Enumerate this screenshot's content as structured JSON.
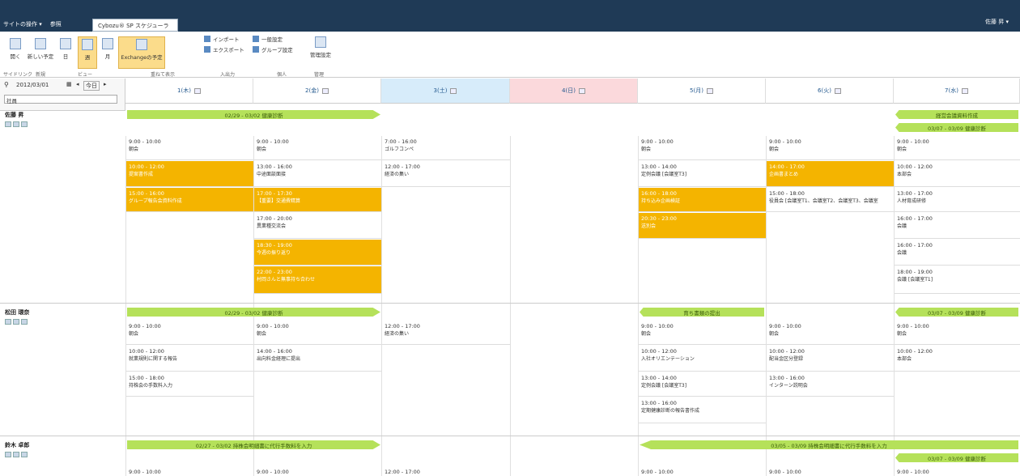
{
  "topbar": {
    "menu": [
      "サイトの操作 ▾",
      "参照"
    ],
    "tab": "Cybozu® SP スケジューラー",
    "user": "佐藤 昇 ▾"
  },
  "ribbon": {
    "open": "開く",
    "new": "新しい予定",
    "day": "日",
    "week": "週",
    "month": "月",
    "exchange": "Exchangeの予定",
    "import": "インポート",
    "export": "エクスポート",
    "general": "一般設定",
    "group": "グループ設定",
    "admin": "管理設定",
    "groups": [
      "サイドリンク",
      "新規",
      "ビュー",
      "重ねて表示",
      "入出力",
      "個人",
      "管理"
    ]
  },
  "nav": {
    "date": "2012/03/01",
    "today": "今日",
    "kind": "社員"
  },
  "days": [
    "1(木)",
    "2(金)",
    "3(土)",
    "4(日)",
    "5(月)",
    "6(火)",
    "7(水)"
  ],
  "people": [
    {
      "name": "佐藤 昇",
      "banners": [
        {
          "t": "02/29 - 03/02 健康診断"
        },
        {
          "t": "経営会議資料作成"
        },
        {
          "t": "03/07 - 03/09 健康診断"
        }
      ],
      "events": [
        {
          "t": "9:00 - 10:00",
          "s": "朝会"
        },
        {
          "t": "10:00 - 12:00",
          "s": "提案書作成"
        },
        {
          "t": "15:00 - 16:00",
          "s": "グループ報告会資料作成"
        },
        {
          "t": "9:00 - 10:00",
          "s": "朝会"
        },
        {
          "t": "13:00 - 16:00",
          "s": "中途面談面接"
        },
        {
          "t": "17:00 - 17:30",
          "s": "【重要】交通費精算"
        },
        {
          "t": "17:00 - 20:00",
          "s": "異業種交流会"
        },
        {
          "t": "18:30 - 19:00",
          "s": "今週の振り返り"
        },
        {
          "t": "22:00 - 23:00",
          "s": "村岡さんと無事持ち合わせ"
        },
        {
          "t": "7:00 - 16:00",
          "s": "ゴルフコンペ"
        },
        {
          "t": "12:00 - 17:00",
          "s": "経済の集い"
        },
        {
          "t": "9:00 - 10:00",
          "s": "朝会"
        },
        {
          "t": "13:00 - 14:00",
          "s": "定例会議 [会議室T3]"
        },
        {
          "t": "16:00 - 18:00",
          "s": "持ち込み企画検証"
        },
        {
          "t": "20:30 - 23:00",
          "s": "送別会"
        },
        {
          "t": "9:00 - 10:00",
          "s": "朝会"
        },
        {
          "t": "14:00 - 17:00",
          "s": "企画書まとめ"
        },
        {
          "t": "15:00 - 18:00",
          "s": "役員会 [会議室T1、会議室T2、会議室T3、会議室"
        },
        {
          "t": "9:00 - 10:00",
          "s": "朝会"
        },
        {
          "t": "10:00 - 12:00",
          "s": "本部会"
        },
        {
          "t": "13:00 - 17:00",
          "s": "人材育成研修"
        },
        {
          "t": "16:00 - 17:00",
          "s": "会議"
        },
        {
          "t": "16:00 - 17:00",
          "s": "会議"
        },
        {
          "t": "18:00 - 19:00",
          "s": "会議 [会議室T1]"
        }
      ]
    },
    {
      "name": "松田 環奈",
      "banners": [
        {
          "t": "02/29 - 03/02 健康診断"
        },
        {
          "t": "育ち書類の提出"
        },
        {
          "t": "03/07 - 03/09 健康診断"
        }
      ],
      "events": [
        {
          "t": "9:00 - 10:00",
          "s": "朝会"
        },
        {
          "t": "10:00 - 12:00",
          "s": "就業規則に関する報告"
        },
        {
          "t": "15:00 - 18:00",
          "s": "持株会の手数料入力"
        },
        {
          "t": "9:00 - 10:00",
          "s": "朝会"
        },
        {
          "t": "14:00 - 16:00",
          "s": "出向料金経理に提出"
        },
        {
          "t": "12:00 - 17:00",
          "s": "経済の集い"
        },
        {
          "t": "9:00 - 10:00",
          "s": "朝会"
        },
        {
          "t": "10:00 - 12:00",
          "s": "入社オリエンテーション"
        },
        {
          "t": "13:00 - 14:00",
          "s": "定例会議 [会議室T3]"
        },
        {
          "t": "13:00 - 16:00",
          "s": "定期健康診断の報告書作成"
        },
        {
          "t": "9:00 - 10:00",
          "s": "朝会"
        },
        {
          "t": "10:00 - 12:00",
          "s": "配当金区分登録"
        },
        {
          "t": "13:00 - 16:00",
          "s": "インターン説明会"
        },
        {
          "t": "9:00 - 10:00",
          "s": "朝会"
        },
        {
          "t": "10:00 - 12:00",
          "s": "本部会"
        }
      ]
    },
    {
      "name": "鈴木 卓郎",
      "banners": [
        {
          "t": "02/27 - 03/02 持株会明細書に代行手数料を入力"
        },
        {
          "t": "03/05 - 03/09 持株会明細書に代行手数料を入力"
        },
        {
          "t": "03/07 - 03/09 健康診断"
        }
      ],
      "events": [
        {
          "t": "9:00 - 10:00"
        },
        {
          "t": "9:00 - 10:00"
        },
        {
          "t": "12:00 - 17:00"
        },
        {
          "t": "9:00 - 10:00"
        },
        {
          "t": "9:00 - 10:00"
        },
        {
          "t": "9:00 - 10:00"
        }
      ]
    }
  ]
}
